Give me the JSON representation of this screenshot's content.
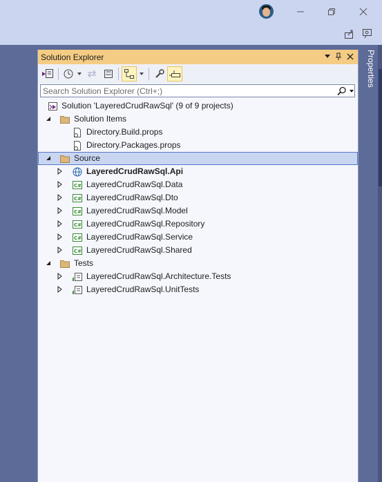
{
  "window": {
    "minimize_icon": "minimize-icon",
    "restore_icon": "restore-icon",
    "close_icon": "close-icon"
  },
  "colors": {
    "titlebar": "#ccd5f0",
    "panel_header": "#f5cc84",
    "selection": "#c9d6f2",
    "background": "#5d6b99"
  },
  "side_tab": {
    "label": "Properties"
  },
  "panel": {
    "title": "Solution Explorer",
    "search": {
      "placeholder": "Search Solution Explorer (Ctrl+;)",
      "value": ""
    }
  },
  "tree": {
    "solution": "Solution 'LayeredCrudRawSql' (9 of 9 projects)",
    "solution_items_folder": "Solution Items",
    "solution_items": [
      "Directory.Build.props",
      "Directory.Packages.props"
    ],
    "source_folder": "Source",
    "source_projects": [
      "LayeredCrudRawSql.Api",
      "LayeredCrudRawSql.Data",
      "LayeredCrudRawSql.Dto",
      "LayeredCrudRawSql.Model",
      "LayeredCrudRawSql.Repository",
      "LayeredCrudRawSql.Service",
      "LayeredCrudRawSql.Shared"
    ],
    "tests_folder": "Tests",
    "test_projects": [
      "LayeredCrudRawSql.Architecture.Tests",
      "LayeredCrudRawSql.UnitTests"
    ]
  }
}
